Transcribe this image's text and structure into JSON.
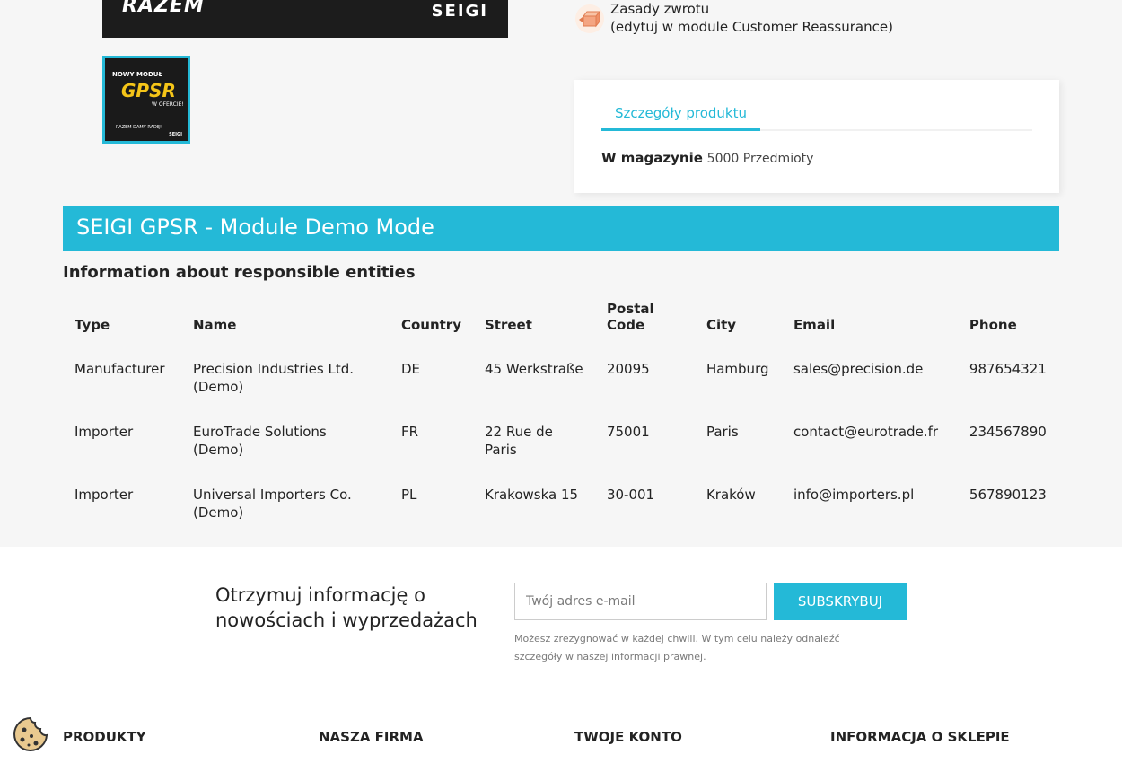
{
  "product_image": {
    "promo_text": "RAZEM ",
    "brand": "SEIGI"
  },
  "thumbnail": {
    "line1": "NOWY MODUŁ",
    "line2": "GPSR",
    "line3": "W OFERCIE!",
    "line4": "RAZEM DAMY RADĘ!",
    "brand": "SEIGI"
  },
  "reassurance": {
    "icon": "package-return-icon",
    "line1": "Zasady zwrotu",
    "line2": "(edytuj w module Customer Reassurance)"
  },
  "details": {
    "tab_label": "Szczegóły produktu",
    "stock_label": "W magazynie",
    "stock_value": "5000 Przedmioty"
  },
  "gpsr": {
    "title": "SEIGI GPSR - Module Demo Mode",
    "subtitle": "Information about responsible entities",
    "columns": [
      "Type",
      "Name",
      "Country",
      "Street",
      "Postal Code",
      "City",
      "Email",
      "Phone"
    ],
    "rows": [
      [
        "Manufacturer",
        "Precision Industries Ltd. (Demo)",
        "DE",
        "45 Werkstraße",
        "20095",
        "Hamburg",
        "sales@precision.de",
        "987654321"
      ],
      [
        "Importer",
        "EuroTrade Solutions (Demo)",
        "FR",
        "22 Rue de Paris",
        "75001",
        "Paris",
        "contact@eurotrade.fr",
        "234567890"
      ],
      [
        "Importer",
        "Universal Importers Co. (Demo)",
        "PL",
        "Krakowska 15",
        "30-001",
        "Kraków",
        "info@importers.pl",
        "567890123"
      ]
    ]
  },
  "newsletter": {
    "title": "Otrzymuj informację o nowościach i wyprzedażach",
    "placeholder": "Twój adres e-mail",
    "button": "Subskrybuj",
    "legal": "Możesz zrezygnować w każdej chwili. W tym celu należy odnaleźć szczegóły w naszej informacji prawnej."
  },
  "footer": {
    "col1": "PRODUKTY",
    "col2": "NASZA FIRMA",
    "col3": "TWOJE KONTO",
    "col4": "INFORMACJA O SKLEPIE"
  },
  "colors": {
    "accent": "#24b9d7",
    "background": "#f6f6f6"
  }
}
